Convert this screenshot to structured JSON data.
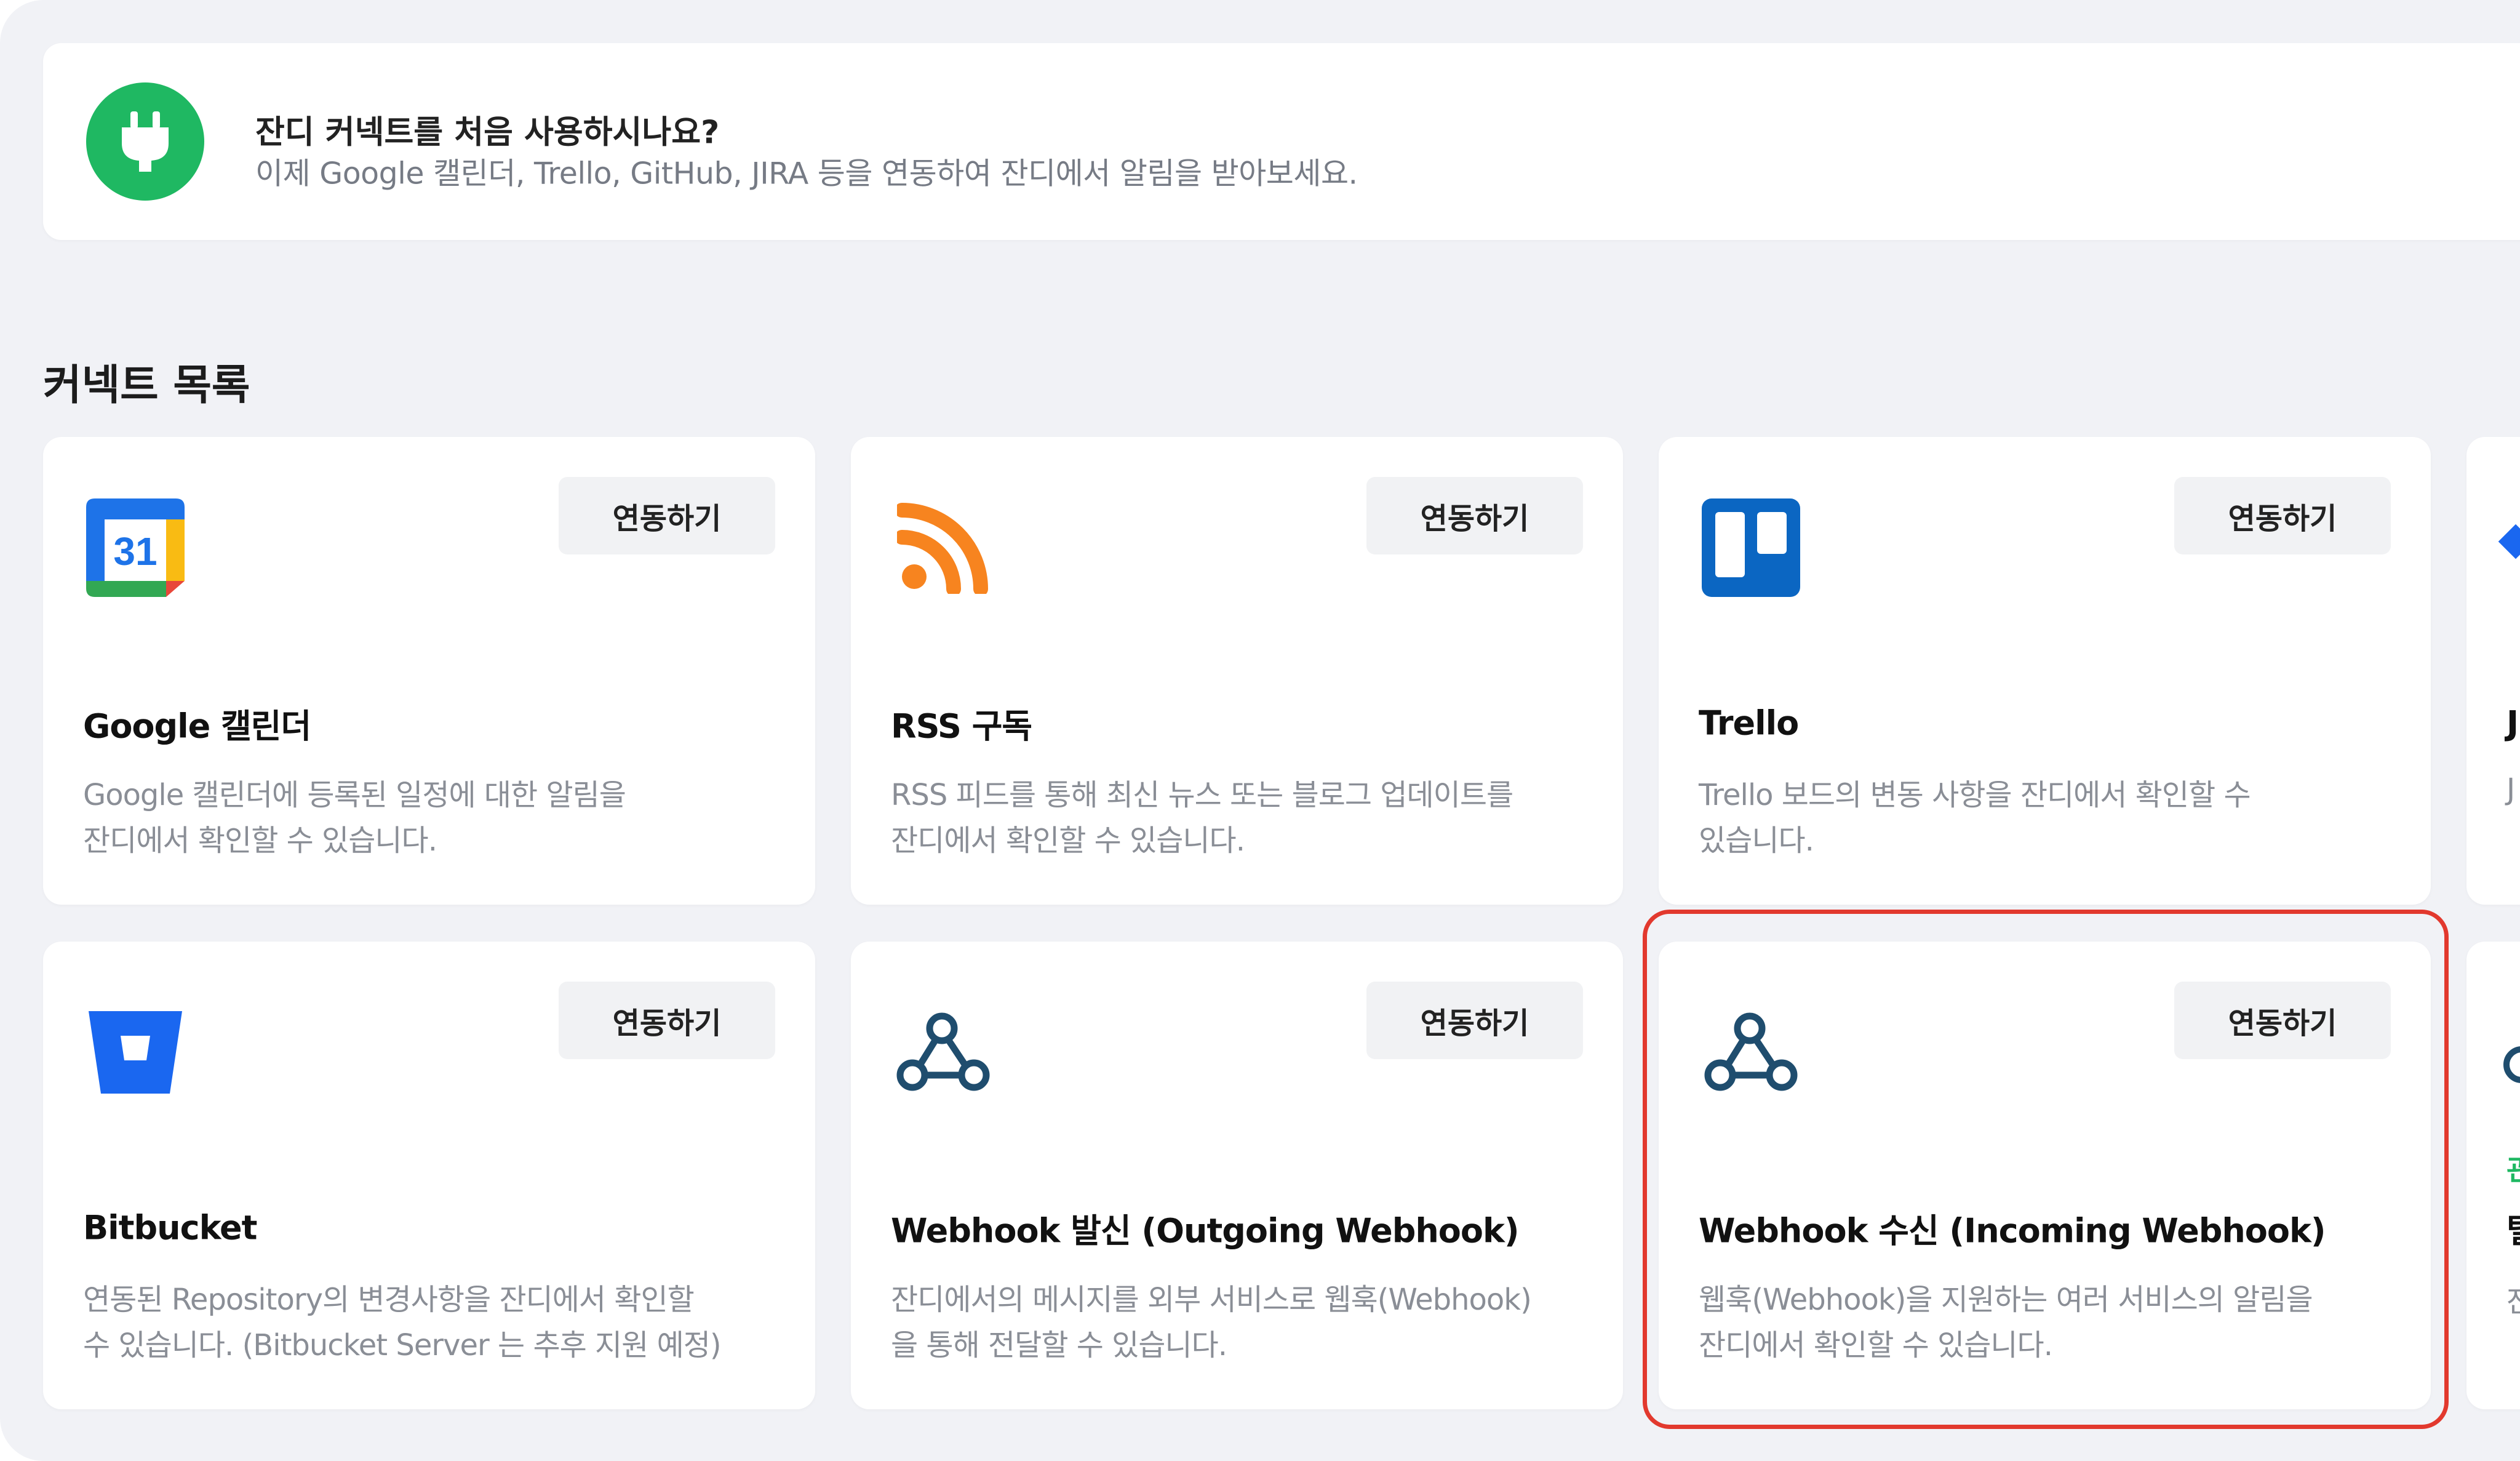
{
  "banner": {
    "title": "잔디 커넥트를 처음 사용하시나요?",
    "description": "이제 Google 캘린더, Trello, GitHub, JIRA 등을 연동하여 잔디에서 알림을 받아보세요.",
    "icon": "plug-icon",
    "accent_color": "#1fb862"
  },
  "section_title": "커넥트 목록",
  "link_label": "연동하기",
  "cards": [
    {
      "title": "Google 캘린더",
      "icon": "google-calendar-icon",
      "icon_text": "31",
      "description": [
        "Google 캘린더에 등록된 일정에 대한 알림을",
        "잔디에서 확인할 수 있습니다."
      ]
    },
    {
      "title": "RSS 구독",
      "icon": "rss-icon",
      "description": [
        "RSS 피드를 통해 최신 뉴스 또는 블로그 업데이트를",
        "잔디에서 확인할 수 있습니다."
      ]
    },
    {
      "title": "Trello",
      "icon": "trello-icon",
      "description": [
        "Trello 보드의 변동 사항을 잔디에서 확인할 수",
        "있습니다."
      ]
    },
    {
      "title": "Bitbucket",
      "icon": "bitbucket-icon",
      "description": [
        "연동된 Repository의 변경사항을 잔디에서 확인할",
        "수 있습니다. (Bitbucket Server 는 추후 지원 예정)"
      ]
    },
    {
      "title": "Webhook 발신 (Outgoing Webhook)",
      "icon": "webhook-icon",
      "description": [
        "잔디에서의 메시지를 외부 서비스로 웹훅(Webhook)",
        "을 통해 전달할 수 있습니다."
      ]
    },
    {
      "title": "Webhook 수신 (Incoming Webhook)",
      "icon": "webhook-icon",
      "description": [
        "웹훅(Webhook)을 지원하는 여러 서비스의 알림을",
        "잔디에서 확인할 수 있습니다."
      ],
      "highlighted": true
    }
  ],
  "partial_cards": [
    {
      "title": "J",
      "description": "J"
    },
    {
      "badge": "관",
      "title": "텔",
      "description": "잔"
    }
  ],
  "colors": {
    "panel_bg": "#f1f2f6",
    "highlight": "#e2392e",
    "rss": "#f7841f",
    "trello": "#0b66c2",
    "bitbucket": "#1a67f0",
    "webhook": "#1f4d6e"
  }
}
